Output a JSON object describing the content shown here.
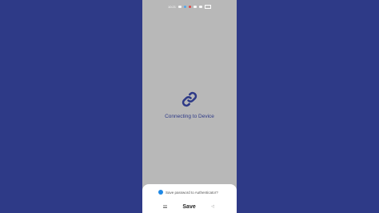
{
  "status_bar": {
    "time": "10:21"
  },
  "main": {
    "connecting_text": "Connecting to Device"
  },
  "save_sheet": {
    "message": "Save password to Authenticator?",
    "save_label": "Save"
  },
  "colors": {
    "background": "#2e3a87",
    "screen": "#b8b8b8",
    "accent": "#2e3a87",
    "key_icon": "#1e88e5"
  },
  "icons": [
    "link-icon",
    "key-icon",
    "menu-icon",
    "back-icon"
  ]
}
